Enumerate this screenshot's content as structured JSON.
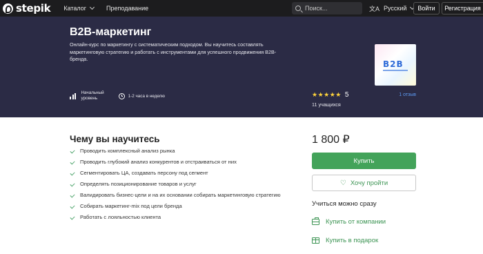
{
  "nav": {
    "logo_text": "stepik",
    "catalog": "Каталог",
    "teach": "Преподавание",
    "search_placeholder": "Поиск...",
    "language": "Русский",
    "login": "Войти",
    "register": "Регистрация"
  },
  "course": {
    "title": "B2B-маркетинг",
    "description": "Онлайн-курс по маркетингу с систематическим подходом. Вы научитесь составлять маркетинговую стратегию и работать с инструментами для успешного продвижения B2B-бренда.",
    "level_line1": "Начальный",
    "level_line2": "уровень",
    "workload": "1-2 часа в неделю",
    "cover_logo": "B2B",
    "rating_stars": 5,
    "rating_value": "5",
    "reviews": "1 отзыв",
    "students": "11 учащихся"
  },
  "learn": {
    "title": "Чему вы научитесь",
    "items": [
      "Проводить комплексный анализ рынка",
      "Проводить глубокий анализ конкурентов и отстраиваться от них",
      "Сегментировать ЦА, создавать персону под сегмент",
      "Определять позиционирование товаров и услуг",
      "Валидировать бизнес-цели и на их основании собирать маркетинговую стратегию",
      "Собирать маркетинг-mix под цели бренда",
      "Работать с лояльностью клиента"
    ]
  },
  "purchase": {
    "price": "1 800 ₽",
    "buy": "Купить",
    "wish": "Хочу пройти",
    "together_title": "Учиться можно сразу",
    "buy_company": "Купить от компании",
    "buy_gift": "Купить в подарок"
  },
  "colors": {
    "nav_bg": "#1c1c1e",
    "hero_bg": "#2b2b45",
    "accent_green": "#43a35a",
    "link_blue": "#5e9cf5",
    "star_yellow": "#ffd43b"
  },
  "icons": [
    "stepik-logo-icon",
    "chevron-down-icon",
    "search-icon",
    "translate-icon",
    "bars-level-icon",
    "clock-icon",
    "star-icon",
    "check-icon",
    "heart-icon",
    "briefcase-icon",
    "gift-icon"
  ]
}
